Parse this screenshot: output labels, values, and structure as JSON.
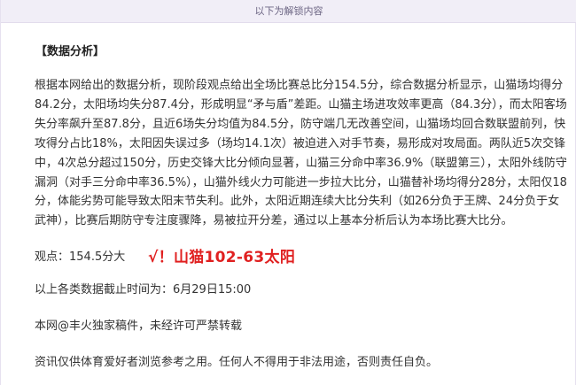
{
  "banner": {
    "text": "以下为解锁内容"
  },
  "section": {
    "title": "【数据分析】"
  },
  "analysis": {
    "paragraph": "根据本网给出的数据分析，现阶段观点给出全场比赛总比分154.5分，综合数据分析显示，山猫场均得分84.2分，太阳场均失分87.4分，形成明显“矛与盾”差距。山猫主场进攻效率更高（84.3分），而太阳客场失分率飙升至87.8分，且近6场失分均值为84.5分，防守端几无改善空间，山猫场均回合数联盟前列，快攻得分占比18%，太阳因失误过多（场均14.1次）被迫进入对手节奏，易形成对攻局面。两队近5次交锋中，4次总分超过150分，历史交锋大比分倾向显著，山猫三分命中率36.9%（联盟第三），太阳外线防守漏洞（对手三分命中率36.5%），山猫外线火力可能进一步拉大比分，山猫替补场均得分28分，太阳仅18分，体能劣势可能导致太阳末节失利。此外，太阳近期连续大比分失利（如26分负于王牌、24分负于女武神），比赛后期防守专注度骤降，易被拉开分差，通过以上基本分析后认为本场比赛大比分。"
  },
  "viewpoint": {
    "label": "观点：154.5分大",
    "result": "√！山猫102-63太阳"
  },
  "deadline": {
    "text": "以上各类数据截止时间为：6月29日15:00"
  },
  "copyright": {
    "text": "本网@丰火独家稿件，未经许可严禁转载"
  },
  "disclaimer": {
    "text": "资讯仅供体育爱好者浏览参考之用。任何人不得用于非法用途，否则责任自负。"
  },
  "colors": {
    "accent_red": "#e02020",
    "banner_bg": "#f1eef7",
    "banner_text": "#6d6684"
  }
}
